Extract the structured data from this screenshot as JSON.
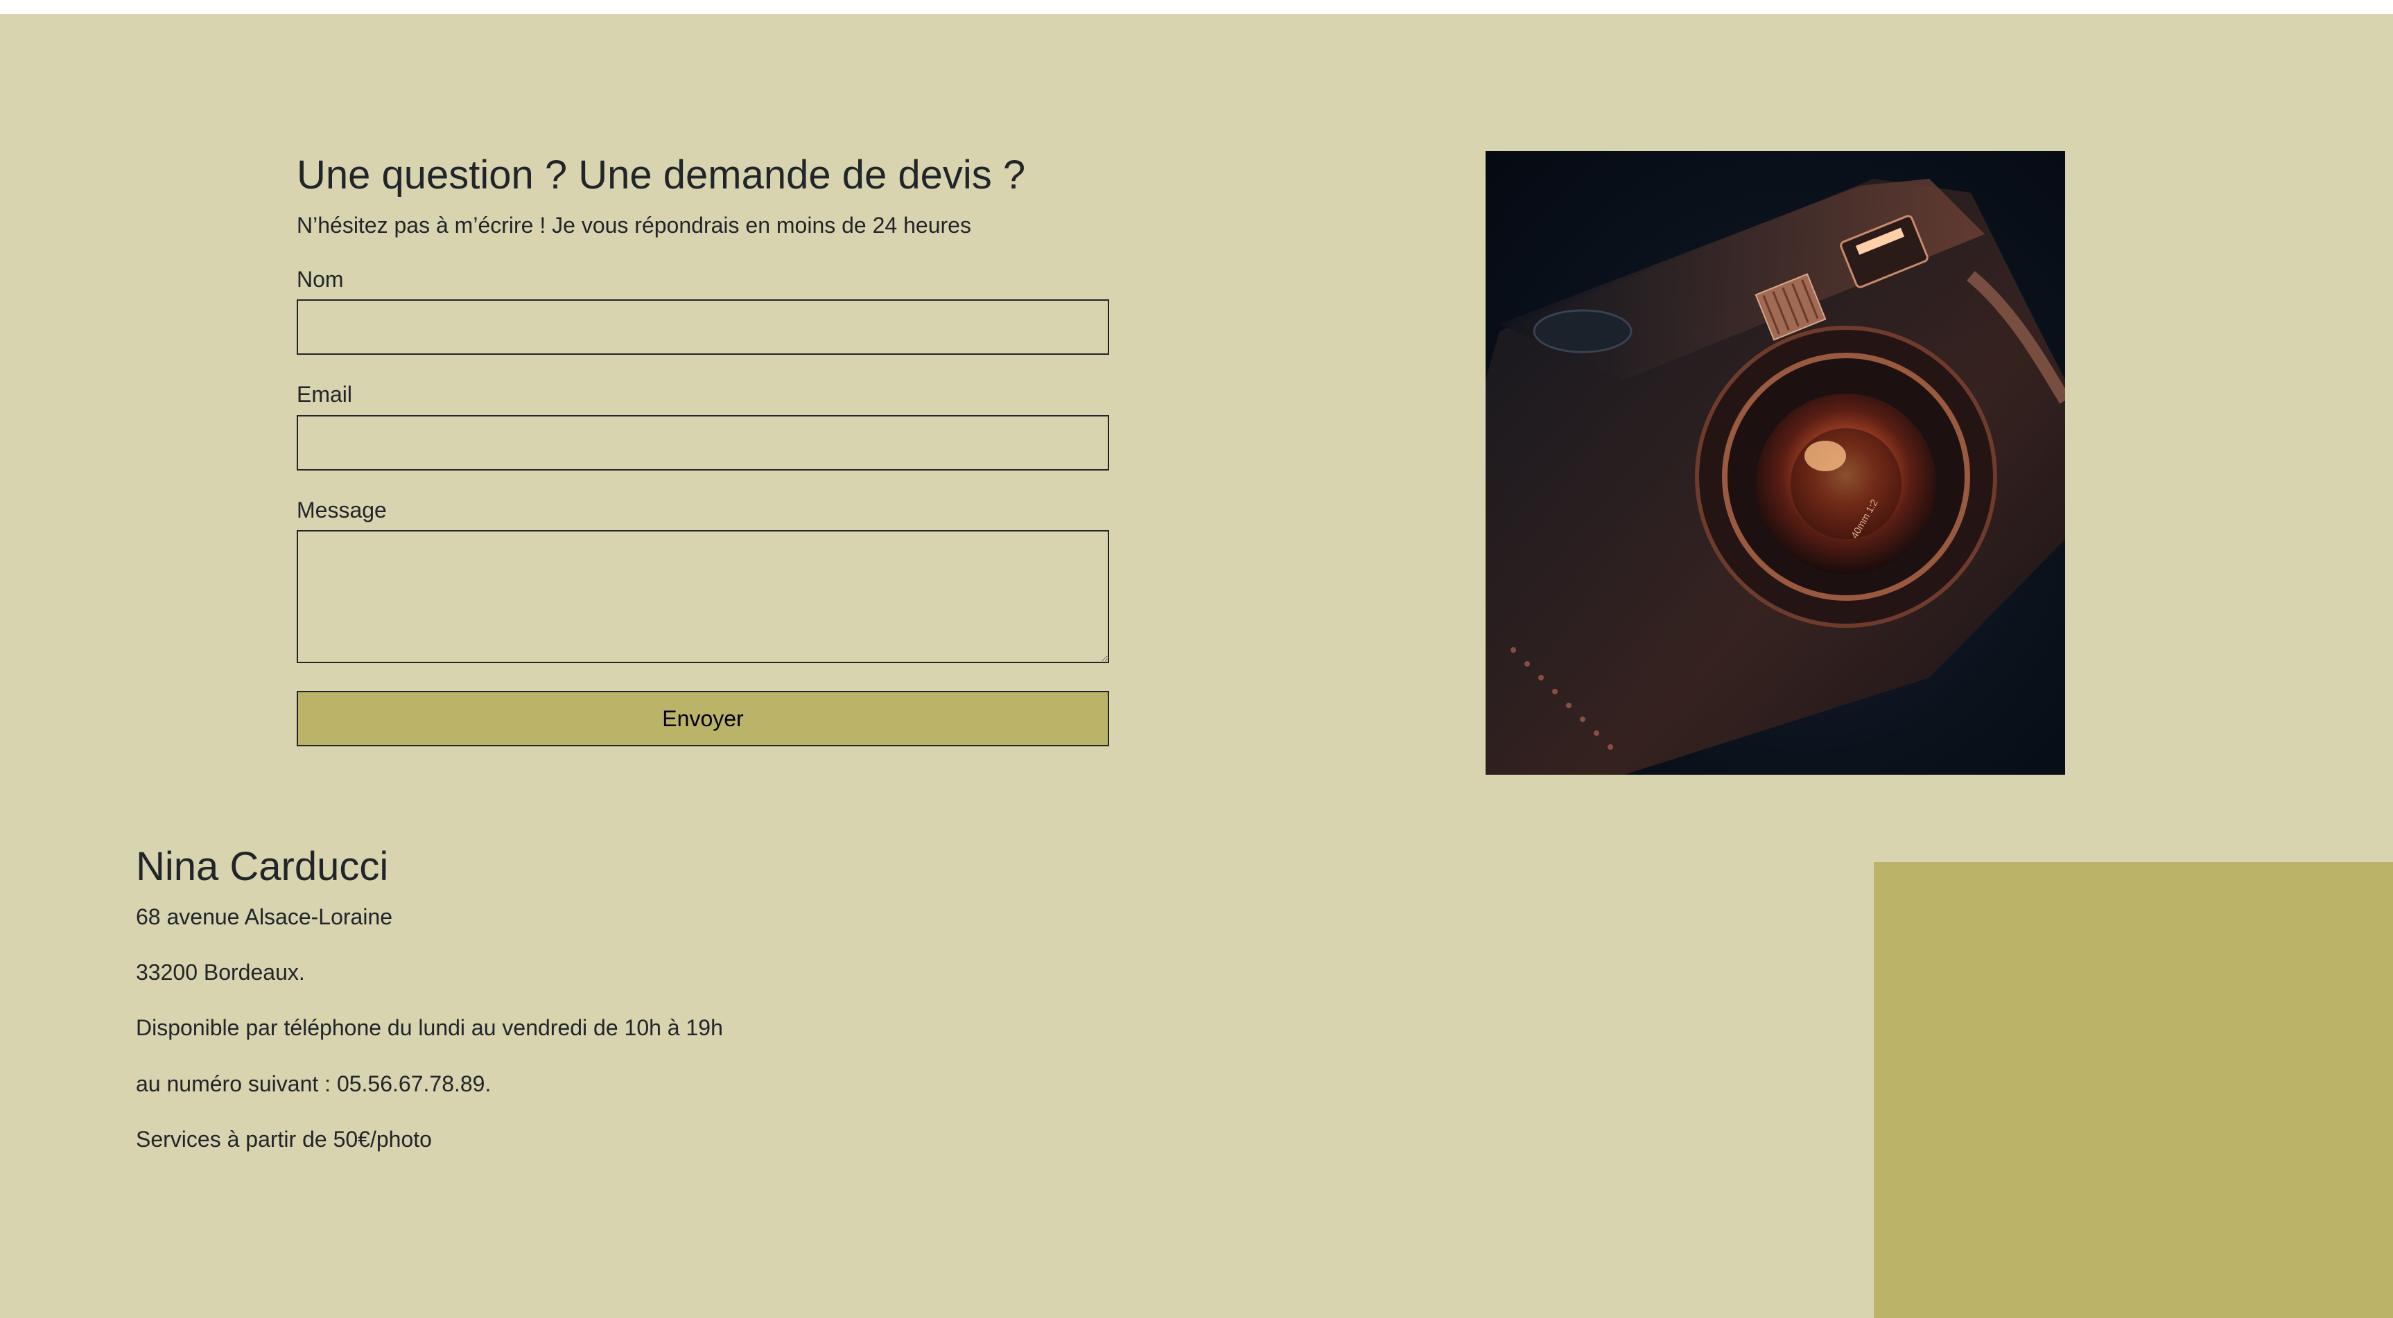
{
  "contact_form": {
    "title": "Une question ? Une demande de devis ?",
    "subtitle": "N’hésitez pas à m’écrire ! Je vous répondrais en moins de 24 heures",
    "name_label": "Nom",
    "email_label": "Email",
    "message_label": "Message",
    "name_value": "",
    "email_value": "",
    "message_value": "",
    "submit_label": "Envoyer"
  },
  "photo": {
    "subject": "camera-photo",
    "lens_text": "40mm 1:2"
  },
  "contact_info": {
    "name": "Nina Carducci",
    "lines": [
      "68 avenue Alsace-Loraine",
      "33200 Bordeaux.",
      "Disponible par téléphone du lundi au vendredi de 10h à 19h",
      "au numéro suivant : 05.56.67.78.89.",
      "Services à partir de 50€/photo"
    ]
  },
  "colors": {
    "background": "#d8d4af",
    "accent": "#bbb468",
    "text": "#212529"
  }
}
